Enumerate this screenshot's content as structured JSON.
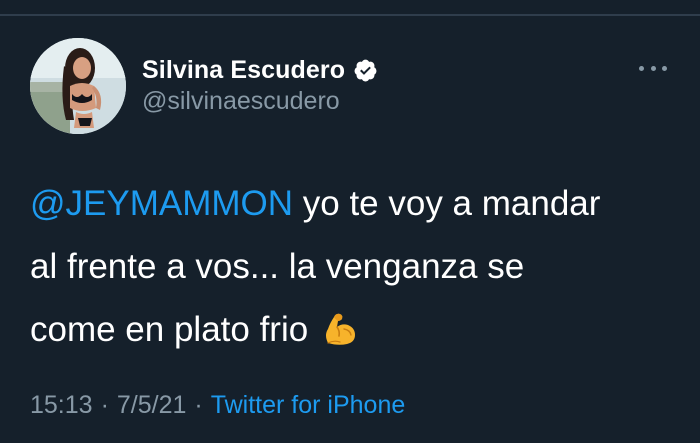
{
  "author": {
    "display_name": "Silvina Escudero",
    "handle": "@silvinaescudero",
    "verified_icon": "verified-badge-icon"
  },
  "tweet": {
    "mention": "@JEYMAMMON",
    "line1_rest": " yo te voy a mandar",
    "line2": "al frente a vos... la venganza se",
    "line3": "come en plato frio",
    "emoji": "flexed-biceps-emoji"
  },
  "meta": {
    "time": "15:13",
    "separator": "·",
    "date": "7/5/21",
    "source": "Twitter for iPhone"
  },
  "colors": {
    "background": "#15202b",
    "link": "#1d9bf0",
    "secondary_text": "#8899a6",
    "primary_text": "#ffffff"
  },
  "icons": {
    "more": "more-options-icon"
  }
}
